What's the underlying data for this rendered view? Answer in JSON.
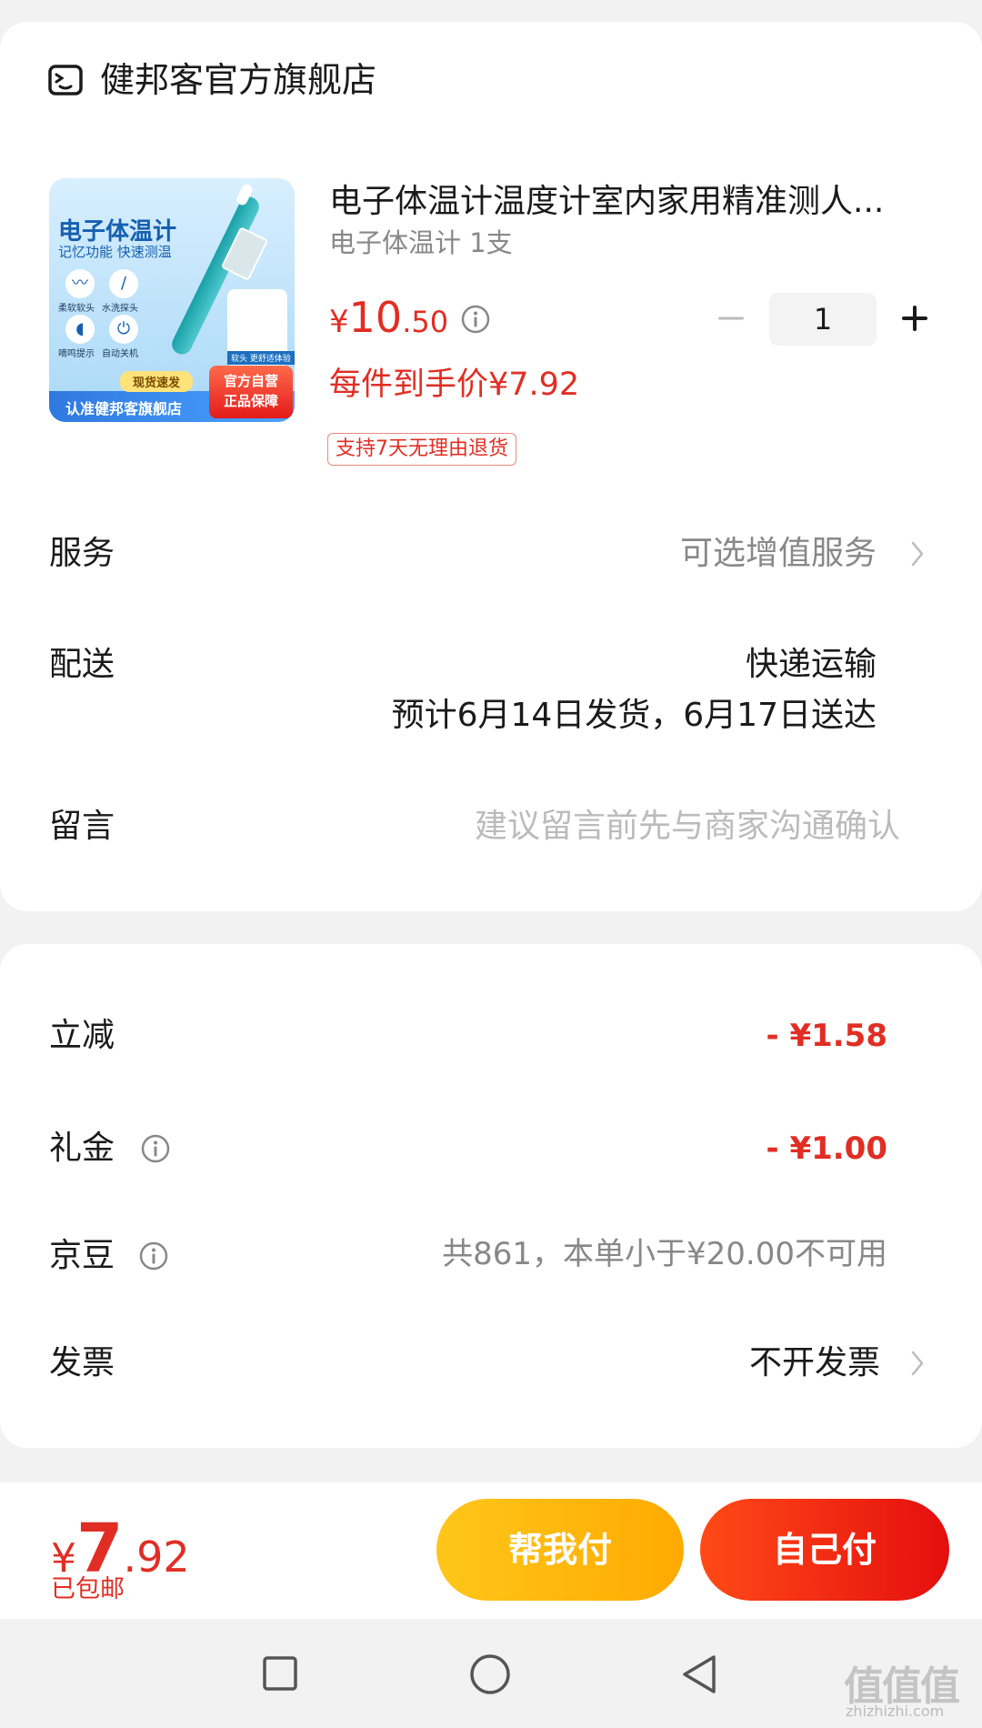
{
  "store": {
    "icon": "store-icon",
    "name": "健邦客官方旗舰店"
  },
  "thumbnail": {
    "title": "电子体温计",
    "subtitle": "记忆功能 快速测温",
    "features": [
      "柔软软头",
      "水洗探头",
      "嘀鸣提示",
      "自动关机"
    ],
    "flex_label": "软头 更舒适体验",
    "speed_tag": "现货速发",
    "bar_text": "认准健邦客旗舰店",
    "badge_line1": "官方自营",
    "badge_line2": "正品保障"
  },
  "product": {
    "title": "电子体温计温度计室内家用精准测人...",
    "spec": "电子体温计 1支",
    "price_symbol": "¥",
    "price_int": "10",
    "price_dec": ".50",
    "quantity": "1",
    "unit_price": "每件到手价¥7.92",
    "return_tag": "支持7天无理由退货"
  },
  "rows": {
    "service_label": "服务",
    "service_value": "可选增值服务",
    "delivery_label": "配送",
    "delivery_method": "快递运输",
    "delivery_estimate": "预计6月14日发货，6月17日送达",
    "message_label": "留言",
    "message_placeholder": "建议留言前先与商家沟通确认"
  },
  "discounts": {
    "instant_label": "立减",
    "instant_value": "- ¥1.58",
    "gift_label": "礼金",
    "gift_value": "- ¥1.00",
    "beans_label": "京豆",
    "beans_value": "共861，本单小于¥20.00不可用",
    "invoice_label": "发票",
    "invoice_value": "不开发票"
  },
  "footer": {
    "total_symbol": "¥",
    "total_int": "7",
    "total_dec": ".92",
    "shipping": "已包邮",
    "help_pay": "帮我付",
    "self_pay": "自己付"
  },
  "watermark": {
    "main": "值值值",
    "url": "zhizhizhi.com"
  },
  "colors": {
    "accent_red": "#e02e24",
    "help_btn": "#ffb400",
    "self_btn": "#f02a14"
  }
}
